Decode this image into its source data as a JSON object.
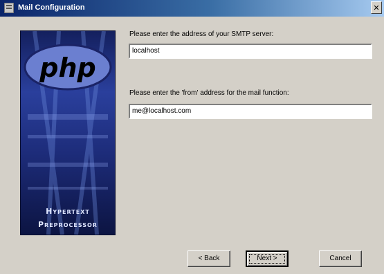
{
  "window": {
    "title": "Mail Configuration",
    "close_glyph": "✕"
  },
  "banner": {
    "logo_text": "php",
    "word1": "Hypertext",
    "word2": "Preprocessor"
  },
  "form": {
    "smtp_label": "Please enter the address of your SMTP server:",
    "smtp_value": "localhost",
    "from_label": "Please enter the 'from' address for the mail function:",
    "from_value": "me@localhost.com"
  },
  "buttons": {
    "back": "< Back",
    "next": "Next >",
    "cancel": "Cancel"
  },
  "colors": {
    "titlebar_start": "#0a246a",
    "titlebar_end": "#a6caf0",
    "dialog_bg": "#d4d0c8",
    "banner_blue": "#2a3f9c"
  }
}
